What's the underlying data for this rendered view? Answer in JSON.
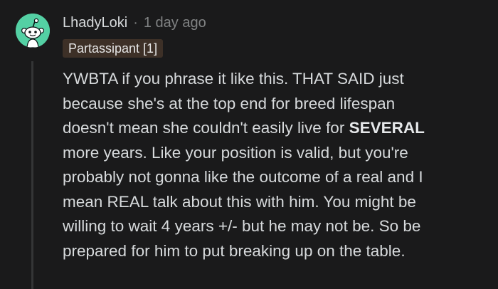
{
  "comment": {
    "username": "LhadyLoki",
    "separator": "·",
    "timestamp": "1 day ago",
    "flair": "Partassipant [1]",
    "avatar_icon": "reddit-snoo-avatar-icon",
    "avatar_color": "#54d0a4",
    "body_lines": [
      {
        "text": "YWBTA if you phrase it like this. THAT SAID just"
      },
      {
        "text": "because she's at the top end for breed lifespan"
      },
      {
        "pre": "doesn't mean she couldn't easily live for ",
        "bold": "SEVERAL"
      },
      {
        "text": "more years. Like your position is valid, but you're"
      },
      {
        "text": "probably not gonna like the outcome of a real and I"
      },
      {
        "text": "mean REAL talk about this with him. You might be"
      },
      {
        "text": "willing to wait 4 years +/- but he may not be. So be"
      },
      {
        "text": "prepared for him to put breaking up on the table."
      }
    ]
  },
  "colors": {
    "background": "#1a1a1b",
    "text": "#d7dadc",
    "muted": "#818384",
    "flair_bg": "#3d3027",
    "thread_line": "#343536"
  }
}
